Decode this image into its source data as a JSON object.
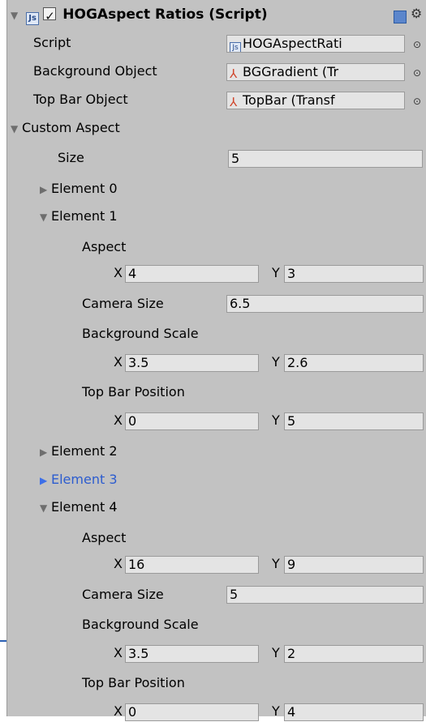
{
  "header": {
    "title": "HOGAspect Ratios (Script)"
  },
  "props": {
    "script": {
      "label": "Script",
      "value": "HOGAspectRati"
    },
    "background": {
      "label": "Background Object",
      "value": "BGGradient (Tr"
    },
    "topbar": {
      "label": "Top Bar Object",
      "value": "TopBar (Transf"
    }
  },
  "custom": {
    "label": "Custom Aspect",
    "size_label": "Size",
    "size_value": "5"
  },
  "elements": {
    "e0": "Element 0",
    "e1": "Element 1",
    "e2": "Element 2",
    "e3": "Element 3",
    "e4": "Element 4"
  },
  "labels": {
    "aspect": "Aspect",
    "camera": "Camera Size",
    "bgscale": "Background Scale",
    "topbarpos": "Top Bar Position",
    "x": "X",
    "y": "Y"
  },
  "e1": {
    "aspect_x": "4",
    "aspect_y": "3",
    "camera": "6.5",
    "bg_x": "3.5",
    "bg_y": "2.6",
    "tb_x": "0",
    "tb_y": "5"
  },
  "e4": {
    "aspect_x": "16",
    "aspect_y": "9",
    "camera": "5",
    "bg_x": "3.5",
    "bg_y": "2",
    "tb_x": "0",
    "tb_y": "4"
  },
  "colors": {
    "panel": "#c2c2c2",
    "field": "#e4e4e4",
    "selected_text": "#2c5ccf"
  },
  "icons": [
    "js-icon",
    "checkbox-icon",
    "help-icon",
    "gear-icon",
    "transform-icon",
    "object-picker-icon",
    "foldout-arrow-icon"
  ]
}
